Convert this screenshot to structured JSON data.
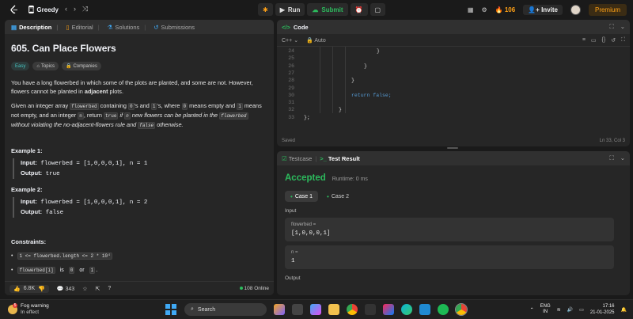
{
  "topbar": {
    "brand": "Greedy",
    "run": "Run",
    "submit": "Submit",
    "streak": "106",
    "invite": "Invite",
    "premium": "Premium"
  },
  "left_tabs": [
    {
      "label": "Description"
    },
    {
      "label": "Editorial"
    },
    {
      "label": "Solutions"
    },
    {
      "label": "Submissions"
    }
  ],
  "problem": {
    "title": "605. Can Place Flowers",
    "tags": {
      "difficulty": "Easy",
      "topics": "Topics",
      "companies": "Companies"
    },
    "p1": "You have a long flowerbed in which some of the plots are planted, and some are not. However, flowers cannot be planted in",
    "p1_bold": "adjacent",
    "p1_end": "plots.",
    "p2": {
      "a": "Given an integer array",
      "code1": "flowerbed",
      "b": "containing",
      "code2": "0",
      "c": "'s and",
      "code3": "1",
      "d": "'s, where",
      "code4": "0",
      "e": "means empty and",
      "code5": "1",
      "f": "means not empty, and an integer",
      "code6": "n",
      "g": ", return",
      "code7": "true",
      "h": "if",
      "code8": "n",
      "i": "new flowers can be planted in the",
      "code9": "flowerbed",
      "j": "without violating the no-adjacent-flowers rule and",
      "code10": "false",
      "k": "otherwise."
    },
    "examples": [
      {
        "heading": "Example 1:",
        "input_label": "Input:",
        "input": "flowerbed = [1,0,0,0,1], n = 1",
        "output_label": "Output:",
        "output": "true"
      },
      {
        "heading": "Example 2:",
        "input_label": "Input:",
        "input": "flowerbed = [1,0,0,0,1], n = 2",
        "output_label": "Output:",
        "output": "false"
      }
    ],
    "constraints_heading": "Constraints:",
    "constraint1": "1 <= flowerbed.length <= 2 * 10⁴",
    "constraint2_code": "flowerbed[i]",
    "constraint2_a": "is",
    "constraint2_code2": "0",
    "constraint2_b": "or",
    "constraint2_code3": "1",
    "constraint2_end": "."
  },
  "left_footer": {
    "likes": "6.8K",
    "comments": "343",
    "online": "108 Online"
  },
  "code": {
    "title": "Code",
    "language": "C++",
    "mode": "Auto",
    "lines": [
      {
        "n": "24",
        "text": "}",
        "indent": 3
      },
      {
        "n": "25",
        "text": "",
        "indent": 0
      },
      {
        "n": "26",
        "text": "}",
        "indent": 2
      },
      {
        "n": "27",
        "text": "",
        "indent": 0
      },
      {
        "n": "28",
        "text": "}",
        "indent": 1
      },
      {
        "n": "29",
        "text": "",
        "indent": 0
      },
      {
        "n": "30",
        "text": "return false;",
        "indent": 1
      },
      {
        "n": "31",
        "text": "",
        "indent": 0
      },
      {
        "n": "32",
        "text": "}",
        "indent": 0.5
      },
      {
        "n": "33",
        "text": "};",
        "indent": 0
      }
    ],
    "saved": "Saved",
    "cursor": "Ln 33, Col 3"
  },
  "test": {
    "tab_testcase": "Testcase",
    "tab_result": "Test Result",
    "status": "Accepted",
    "runtime": "Runtime: 0 ms",
    "case1": "Case 1",
    "case2": "Case 2",
    "input_label": "Input",
    "var1_name": "flowerbed =",
    "var1_value": "[1,0,0,0,1]",
    "var2_name": "n =",
    "var2_value": "1",
    "output_label": "Output"
  },
  "taskbar": {
    "weather_title": "Fog warning",
    "weather_sub": "In effect",
    "weather_badge": "5",
    "search": "Search",
    "lang1": "ENG",
    "lang2": "IN",
    "time": "17:16",
    "date": "21-01-2025"
  },
  "colors": {
    "accent_green": "#2cbb5d",
    "streak_orange": "#ffa116",
    "easy_teal": "#46c6c2"
  }
}
